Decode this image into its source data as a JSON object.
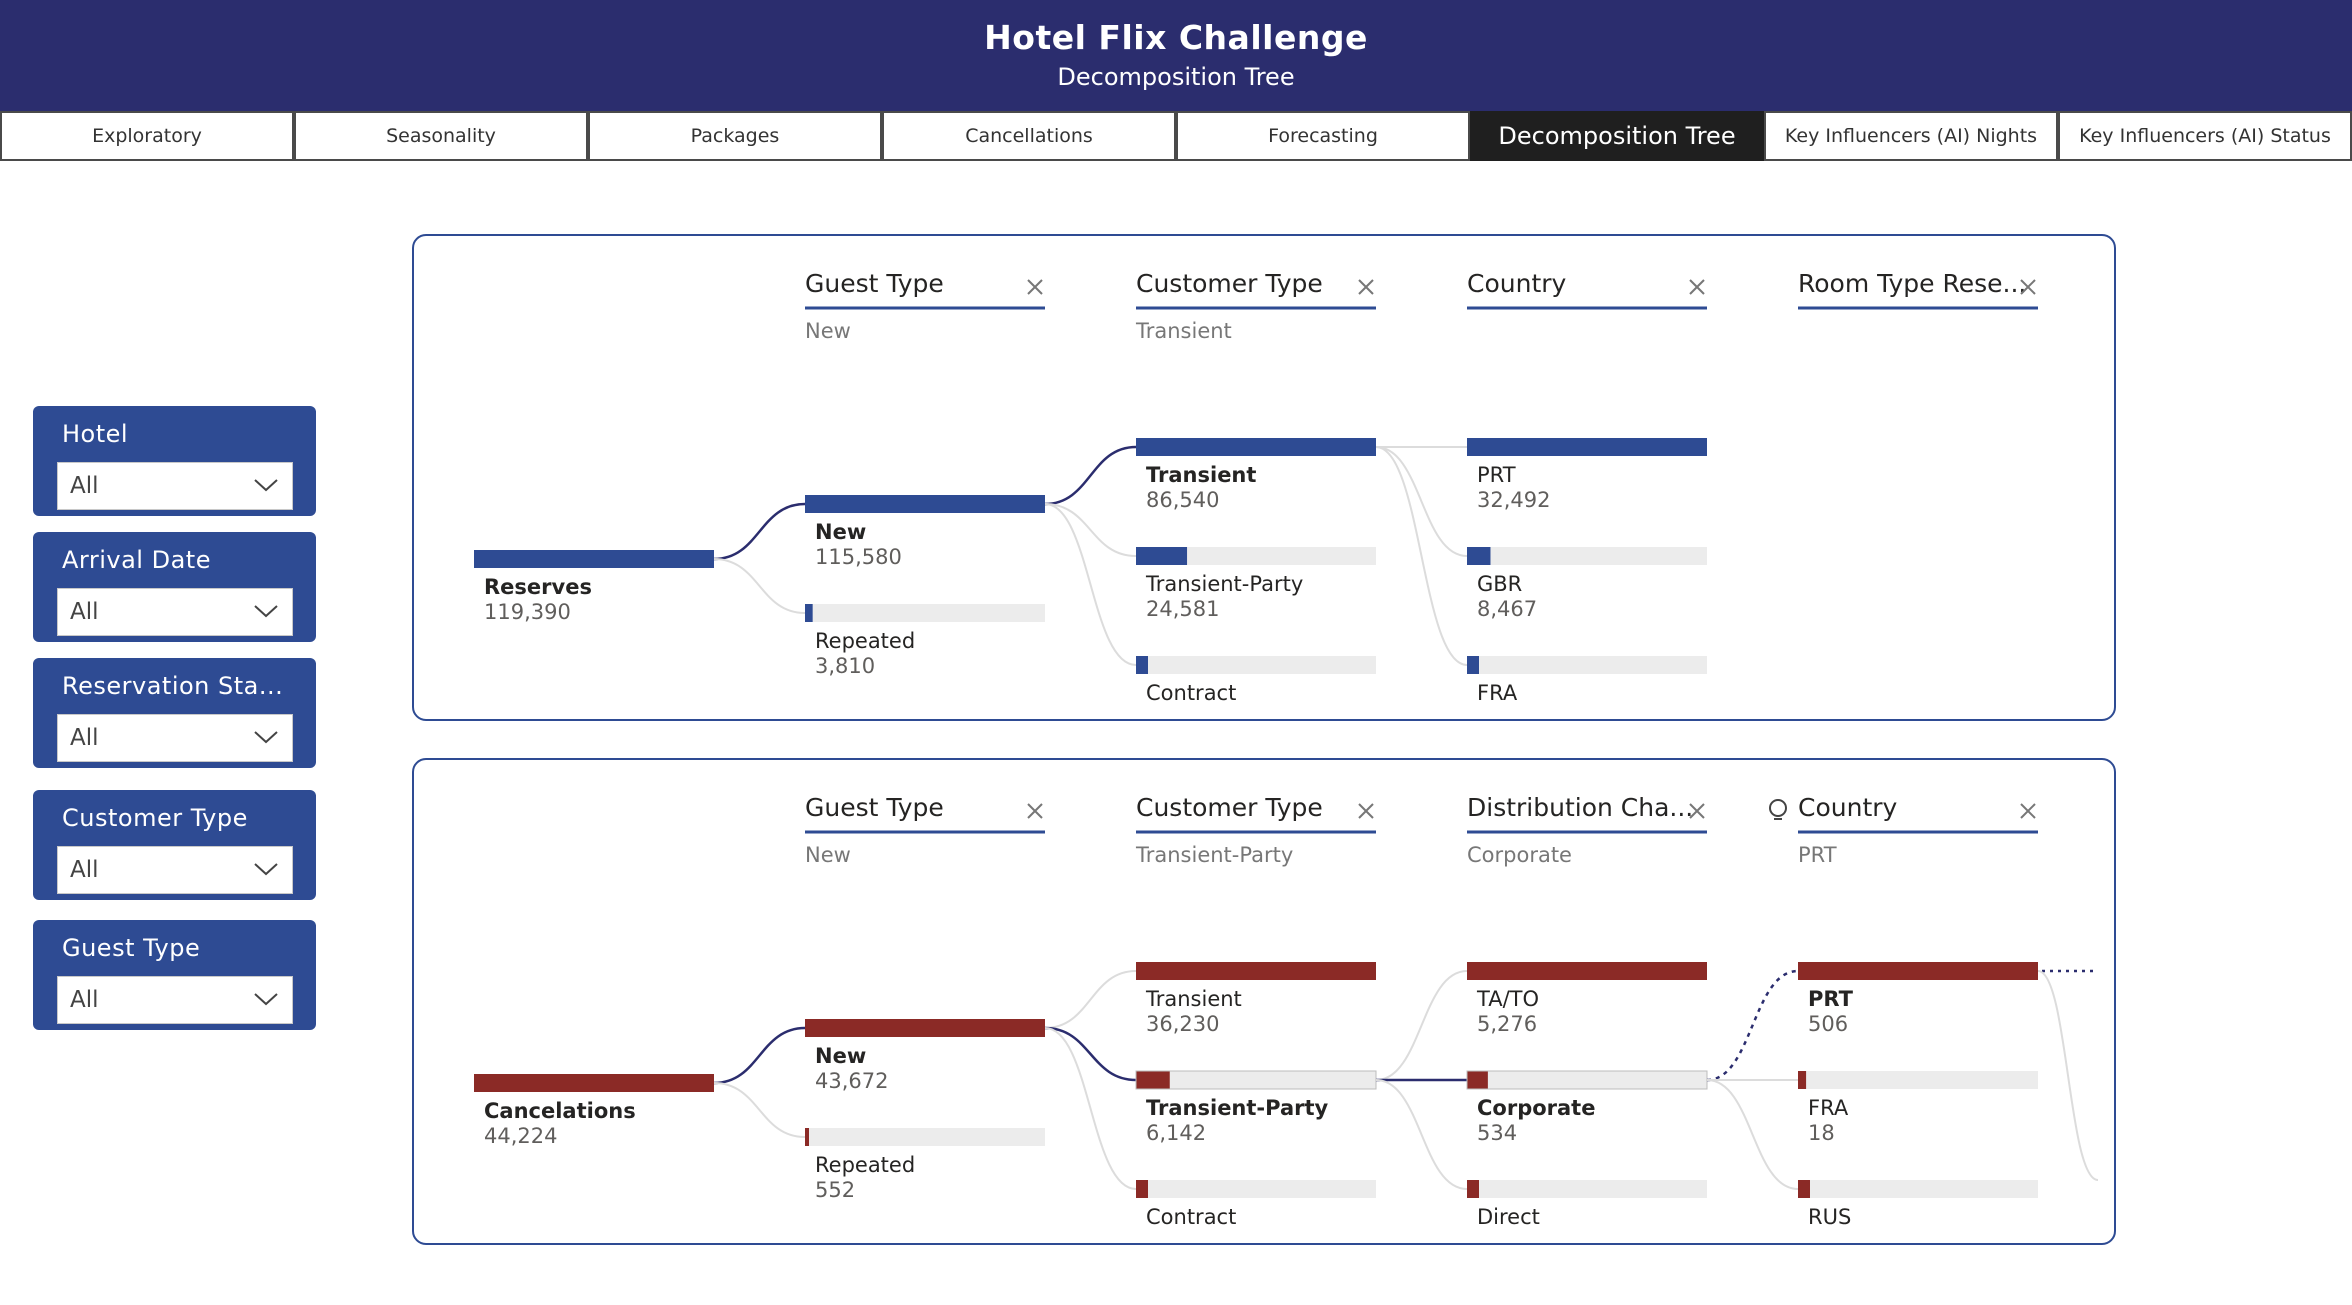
{
  "header": {
    "title": "Hotel Flix Challenge",
    "subtitle": "Decomposition Tree"
  },
  "tabs": [
    {
      "label": "Exploratory"
    },
    {
      "label": "Seasonality"
    },
    {
      "label": "Packages"
    },
    {
      "label": "Cancellations"
    },
    {
      "label": "Forecasting"
    },
    {
      "label": "Decomposition Tree",
      "active": true
    },
    {
      "label": "Key Influencers (AI) Nights"
    },
    {
      "label": "Key Influencers (AI) Status"
    }
  ],
  "slicers": [
    {
      "title": "Hotel",
      "value": "All"
    },
    {
      "title": "Arrival Date",
      "value": "All"
    },
    {
      "title": "Reservation Sta...",
      "value": "All"
    },
    {
      "title": "Customer Type",
      "value": "All"
    },
    {
      "title": "Guest Type",
      "value": "All"
    }
  ],
  "colors": {
    "header_bg": "#2b2d6e",
    "slicer_bg": "#2e4b93",
    "reserves_bar": "#2e4b93",
    "cancel_bar": "#8b2a26",
    "bar_track": "#ececec"
  },
  "chart_data": [
    {
      "type": "decomposition-tree",
      "root": {
        "label": "Reserves",
        "value": 119390
      },
      "levels": [
        {
          "header": "Guest Type",
          "selected": "New",
          "nodes": [
            {
              "label": "New",
              "value": 115580,
              "bold": true
            },
            {
              "label": "Repeated",
              "value": 3810
            }
          ]
        },
        {
          "header": "Customer Type",
          "selected": "Transient",
          "nodes": [
            {
              "label": "Transient",
              "value": 86540,
              "bold": true
            },
            {
              "label": "Transient-Party",
              "value": 24581
            },
            {
              "label": "Contract",
              "value": null
            }
          ]
        },
        {
          "header": "Country",
          "selected": "",
          "nodes": [
            {
              "label": "PRT",
              "value": 32492
            },
            {
              "label": "GBR",
              "value": 8467
            },
            {
              "label": "FRA",
              "value": null
            }
          ]
        },
        {
          "header": "Room Type Rese...",
          "selected": "",
          "nodes": []
        }
      ]
    },
    {
      "type": "decomposition-tree",
      "root": {
        "label": "Cancelations",
        "value": 44224
      },
      "levels": [
        {
          "header": "Guest Type",
          "selected": "New",
          "nodes": [
            {
              "label": "New",
              "value": 43672,
              "bold": true
            },
            {
              "label": "Repeated",
              "value": 552
            }
          ]
        },
        {
          "header": "Customer Type",
          "selected": "Transient-Party",
          "nodes": [
            {
              "label": "Transient",
              "value": 36230
            },
            {
              "label": "Transient-Party",
              "value": 6142,
              "bold": true
            },
            {
              "label": "Contract",
              "value": null
            }
          ]
        },
        {
          "header": "Distribution Cha...",
          "selected": "Corporate",
          "nodes": [
            {
              "label": "TA/TO",
              "value": 5276
            },
            {
              "label": "Corporate",
              "value": 534,
              "bold": true
            },
            {
              "label": "Direct",
              "value": null
            }
          ]
        },
        {
          "header": "Country",
          "selected": "PRT",
          "ai_split": true,
          "nodes": [
            {
              "label": "PRT",
              "value": 506,
              "bold": true
            },
            {
              "label": "FRA",
              "value": 18
            },
            {
              "label": "RUS",
              "value": null
            }
          ]
        }
      ]
    }
  ]
}
